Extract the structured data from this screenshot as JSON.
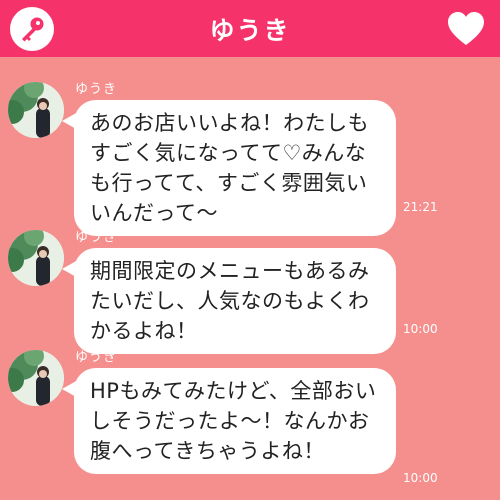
{
  "header": {
    "title": "ゆうき",
    "left_icon": "key-icon",
    "right_icon": "heart-icon"
  },
  "colors": {
    "header": "#f5336a",
    "background": "#f58f8d",
    "bubble": "#ffffff"
  },
  "messages": [
    {
      "sender": "ゆうき",
      "text": "あのお店いいよね！わたしもすごく気になってて♡みんなも行ってて、すごく雰囲気いいんだって〜",
      "time": "21:21"
    },
    {
      "sender": "ゆうき",
      "text": "期間限定のメニューもあるみたいだし、人気なのもよくわかるよね！",
      "time": "10:00"
    },
    {
      "sender": "ゆうき",
      "text": "HPもみてみたけど、全部おいしそうだったよ〜！なんかお腹へってきちゃうよね！",
      "time": "10:00"
    }
  ]
}
